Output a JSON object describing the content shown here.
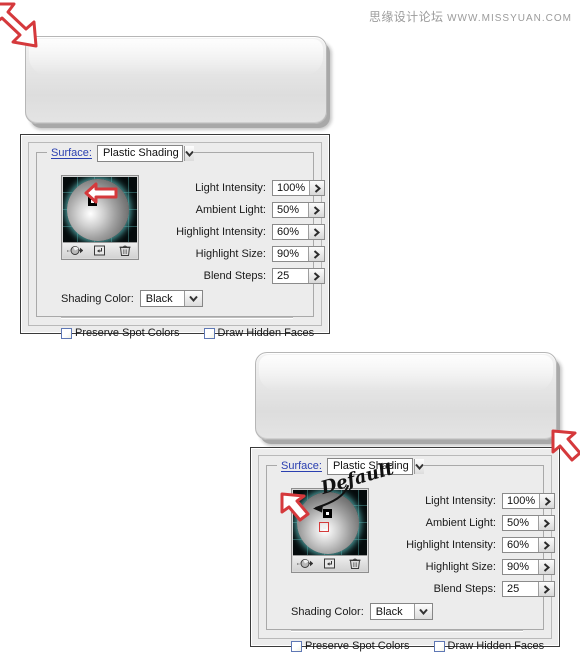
{
  "watermark": {
    "cn": "思缘设计论坛",
    "url": "WWW.MISSYUAN.COM"
  },
  "panels": [
    {
      "id": "panel-top",
      "legend_label": "Surface:",
      "surface_value": "Plastic Shading",
      "fields": [
        {
          "label": "Light Intensity:",
          "value": "100%"
        },
        {
          "label": "Ambient Light:",
          "value": "50%"
        },
        {
          "label": "Highlight Intensity:",
          "value": "60%"
        },
        {
          "label": "Highlight Size:",
          "value": "90%"
        },
        {
          "label": "Blend Steps:",
          "value": "25"
        }
      ],
      "shading_color_label": "Shading Color:",
      "shading_color_value": "Black",
      "checkboxes": [
        {
          "label": "Preserve Spot Colors",
          "checked": false
        },
        {
          "label": "Draw Hidden Faces",
          "checked": false
        }
      ],
      "preview_toolbar_icons": [
        "new-light-icon",
        "move-light-to-back-icon",
        "delete-light-icon"
      ]
    },
    {
      "id": "panel-bottom",
      "legend_label": "Surface:",
      "surface_value": "Plastic Shading",
      "annotation": "Default",
      "fields": [
        {
          "label": "Light Intensity:",
          "value": "100%"
        },
        {
          "label": "Ambient Light:",
          "value": "50%"
        },
        {
          "label": "Highlight Intensity:",
          "value": "60%"
        },
        {
          "label": "Highlight Size:",
          "value": "90%"
        },
        {
          "label": "Blend Steps:",
          "value": "25"
        }
      ],
      "shading_color_label": "Shading Color:",
      "shading_color_value": "Black",
      "checkboxes": [
        {
          "label": "Preserve Spot Colors",
          "checked": false
        },
        {
          "label": "Draw Hidden Faces",
          "checked": false
        }
      ],
      "preview_toolbar_icons": [
        "new-light-icon",
        "move-light-to-back-icon",
        "delete-light-icon"
      ]
    }
  ],
  "colors": {
    "legend_link": "#2a3fb0",
    "annotation_red": "#d5393c",
    "panel_bg": "#ececec",
    "preview_grid": "#050b0c",
    "shape_fill": "#e4e4e4"
  }
}
